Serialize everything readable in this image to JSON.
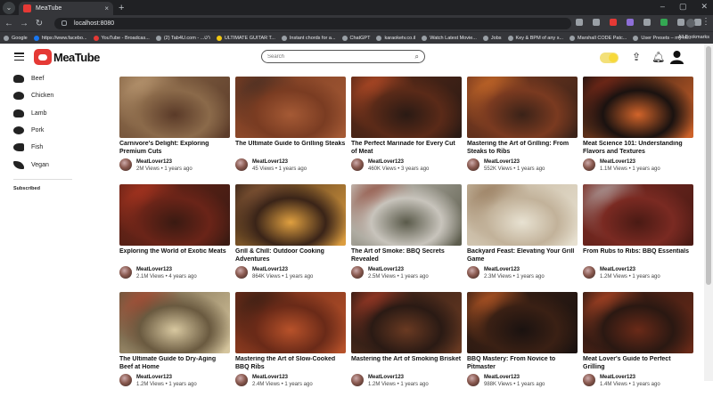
{
  "browser": {
    "tab_title": "MeaTube",
    "url": "localhost:8080",
    "bookmarks": [
      "Google",
      "https://www.facebo...",
      "YouTube - Broadcas...",
      "(2) Tab4U.com - ...רט",
      "ULTIMATE GUITAR T...",
      "Instant chords for a...",
      "ChatGPT",
      "karaoketv.co.il",
      "Watch Latest Movie...",
      "Jobs",
      "Key & BPM of any s...",
      "Marshall CODE Patc...",
      "User Presets – my m..."
    ],
    "all_bookmarks": "All Bookmarks"
  },
  "app": {
    "name": "MeaTube",
    "search_placeholder": "Search"
  },
  "sidebar": {
    "items": [
      {
        "label": "Beef",
        "icon": "cow-icon"
      },
      {
        "label": "Chicken",
        "icon": "chicken-icon"
      },
      {
        "label": "Lamb",
        "icon": "sheep-icon"
      },
      {
        "label": "Pork",
        "icon": "pig-icon"
      },
      {
        "label": "Fish",
        "icon": "fish-icon"
      },
      {
        "label": "Vegan",
        "icon": "plant-icon"
      }
    ],
    "subscribed_heading": "Subscribed"
  },
  "videos": [
    {
      "title": "Carnivore's Delight: Exploring Premium Cuts",
      "channel": "MeatLover123",
      "stats": "2M Views • 1 years ago",
      "palette": [
        "#8b6a4a",
        "#c9a77e",
        "#5a3a28"
      ]
    },
    {
      "title": "The Ultimate Guide to Grilling Steaks",
      "channel": "MeatLover123",
      "stats": "45 Views • 1 years ago",
      "palette": [
        "#7a3c22",
        "#3b2a22",
        "#a55a35"
      ]
    },
    {
      "title": "The Perfect Marinade for Every Cut of Meat",
      "channel": "MeatLover123",
      "stats": "460K Views • 3 years ago",
      "palette": [
        "#5a2a18",
        "#d2552a",
        "#2a1a14"
      ]
    },
    {
      "title": "Mastering the Art of Grilling: From Steaks to Ribs",
      "channel": "MeatLover123",
      "stats": "552K Views • 1 years ago",
      "palette": [
        "#7a3a20",
        "#e0782a",
        "#3a2218"
      ]
    },
    {
      "title": "Meat Science 101: Understanding Flavors and Textures",
      "channel": "MeatLover123",
      "stats": "1.1M Views • 1 years ago",
      "palette": [
        "#1a1210",
        "#8a2a18",
        "#d2642a"
      ]
    },
    {
      "title": "Exploring the World of Exotic Meats",
      "channel": "MeatLover123",
      "stats": "2.1M Views • 4 years ago",
      "palette": [
        "#6a2418",
        "#c03a22",
        "#3a1a12"
      ]
    },
    {
      "title": "Grill & Chill: Outdoor Cooking Adventures",
      "channel": "MeatLover123",
      "stats": "864K Views • 1 years ago",
      "palette": [
        "#3a2418",
        "#8a5a3a",
        "#e0a040"
      ]
    },
    {
      "title": "The Art of Smoke: BBQ Secrets Revealed",
      "channel": "MeatLover123",
      "stats": "2.5M Views • 1 years ago",
      "palette": [
        "#c8c4bc",
        "#8a3a2a",
        "#5a5a4a"
      ]
    },
    {
      "title": "Backyard Feast: Elevating Your Grill Game",
      "channel": "MeatLover123",
      "stats": "2.3M Views • 1 years ago",
      "palette": [
        "#c2b29a",
        "#8a6a4a",
        "#e8e2d2"
      ]
    },
    {
      "title": "From Rubs to Ribs: BBQ Essentials",
      "channel": "MeatLover123",
      "stats": "1.2M Views • 1 years ago",
      "palette": [
        "#7a2a22",
        "#c0c0c0",
        "#4a1a14"
      ]
    },
    {
      "title": "The Ultimate Guide to Dry-Aging Beef at Home",
      "channel": "MeatLover123",
      "stats": "1.2M Views • 1 years ago",
      "palette": [
        "#6a5a40",
        "#b0402a",
        "#d8c8a0"
      ]
    },
    {
      "title": "Mastering the Art of Slow-Cooked BBQ Ribs",
      "channel": "MeatLover123",
      "stats": "2.4M Views • 1 years ago",
      "palette": [
        "#6a2a18",
        "#2a1a12",
        "#b8522a"
      ]
    },
    {
      "title": "Mastering the Art of Smoking Brisket",
      "channel": "MeatLover123",
      "stats": "1.2M Views • 1 years ago",
      "palette": [
        "#2a1a14",
        "#c0422a",
        "#6a3a22"
      ]
    },
    {
      "title": "BBQ Mastery: From Novice to Pitmaster",
      "channel": "MeatLover123",
      "stats": "988K Views • 1 years ago",
      "palette": [
        "#3a2014",
        "#e06a2a",
        "#1a1210"
      ]
    },
    {
      "title": "Meat Lover's Guide to Perfect Grilling",
      "channel": "MeatLover123",
      "stats": "1.4M Views • 1 years ago",
      "palette": [
        "#2a1812",
        "#d2522a",
        "#6a2a18"
      ]
    }
  ]
}
